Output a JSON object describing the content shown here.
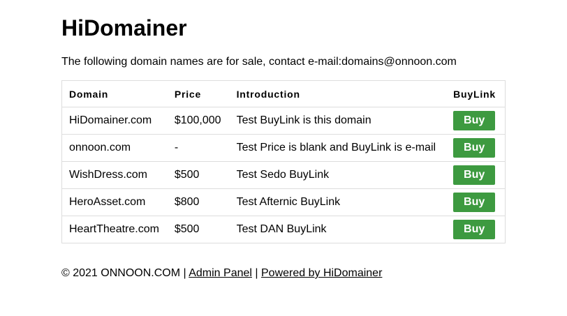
{
  "header": {
    "title": "HiDomainer",
    "intro": "The following domain names are for sale, contact e-mail:domains@onnoon.com"
  },
  "table": {
    "headers": [
      "Domain",
      "Price",
      "Introduction",
      "BuyLink"
    ],
    "rows": [
      {
        "domain": "HiDomainer.com",
        "price": "$100,000",
        "introduction": "Test BuyLink is this domain",
        "buy_label": "Buy"
      },
      {
        "domain": "onnoon.com",
        "price": "-",
        "introduction": "Test Price is blank and BuyLink is e-mail",
        "buy_label": "Buy"
      },
      {
        "domain": "WishDress.com",
        "price": "$500",
        "introduction": "Test Sedo BuyLink",
        "buy_label": "Buy"
      },
      {
        "domain": "HeroAsset.com",
        "price": "$800",
        "introduction": "Test Afternic BuyLink",
        "buy_label": "Buy"
      },
      {
        "domain": "HeartTheatre.com",
        "price": "$500",
        "introduction": "Test DAN BuyLink",
        "buy_label": "Buy"
      }
    ]
  },
  "footer": {
    "copyright": "© 2021 ONNOON.COM",
    "separator": "|",
    "admin_link": "Admin Panel",
    "powered_link": "Powered by HiDomainer"
  },
  "colors": {
    "buy_button": "#3d9a40",
    "table_border": "#dddddd"
  }
}
